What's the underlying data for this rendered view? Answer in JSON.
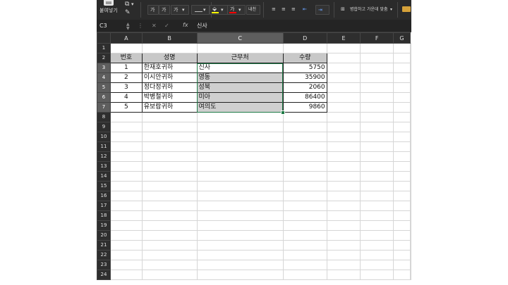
{
  "ribbon": {
    "paste_label": "붙여넣기",
    "font_grow": "가",
    "font_shrink": "가",
    "bold_group": "가",
    "font_color_glyph": "가",
    "phonetic_label": "내천",
    "merge_label": "병합하고 가운데 맞춤",
    "colors": {
      "fill": "#ffff00",
      "font": "#ff0000"
    }
  },
  "formula_bar": {
    "name_box": "C3",
    "fx": "fx",
    "value": "신사"
  },
  "columns": [
    "A",
    "B",
    "C",
    "D",
    "E",
    "F",
    "G"
  ],
  "selected_column": "C",
  "rows": [
    "1",
    "2",
    "3",
    "4",
    "5",
    "6",
    "7",
    "8",
    "9",
    "10",
    "11",
    "12",
    "13",
    "14",
    "15",
    "16",
    "17",
    "18",
    "19",
    "20",
    "21",
    "22",
    "23",
    "24"
  ],
  "table": {
    "headers": [
      "번호",
      "성명",
      "근무처",
      "수량"
    ],
    "records": [
      [
        "1",
        "한재호귀하",
        "신사",
        "5750"
      ],
      [
        "2",
        "이시안귀하",
        "영동",
        "35900"
      ],
      [
        "3",
        "정다정귀하",
        "성북",
        "2060"
      ],
      [
        "4",
        "박병철귀하",
        "미아",
        "86400"
      ],
      [
        "5",
        "유보람귀하",
        "여의도",
        "9860"
      ]
    ]
  }
}
